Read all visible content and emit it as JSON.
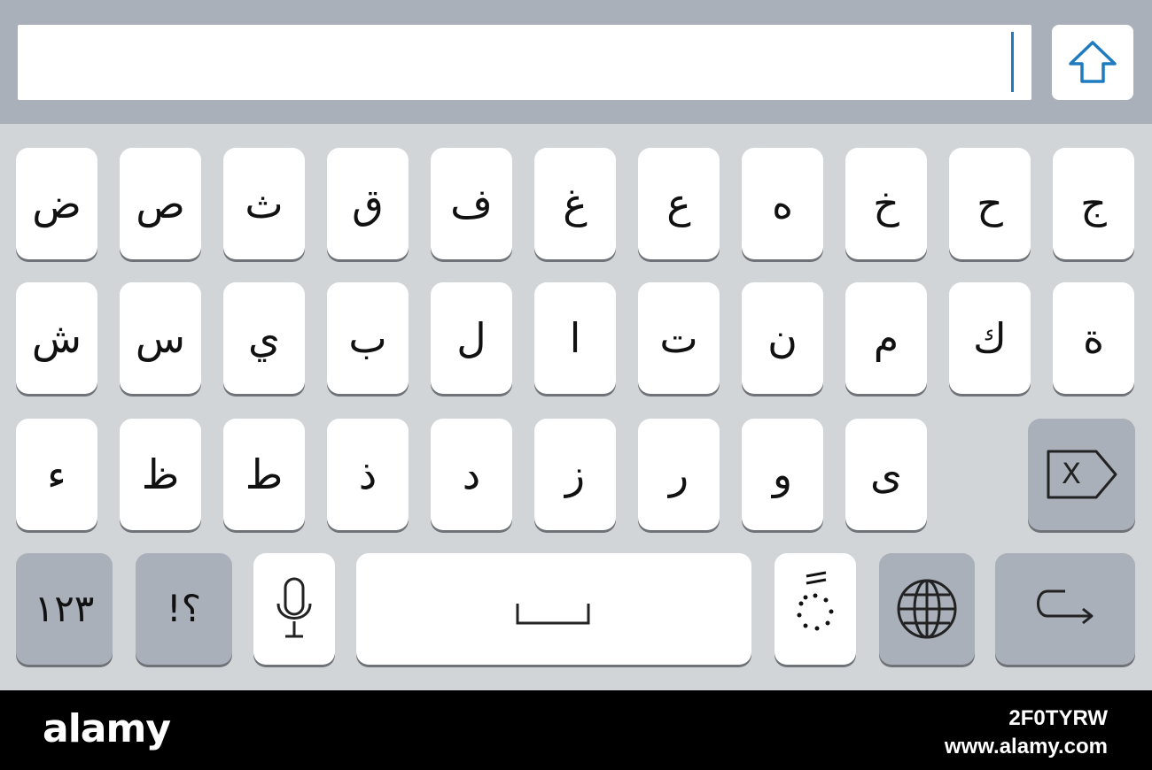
{
  "keyboard": {
    "row1": [
      "ض",
      "ص",
      "ث",
      "ق",
      "ف",
      "غ",
      "ع",
      "ه",
      "خ",
      "ح",
      "ج"
    ],
    "row2": [
      "ش",
      "س",
      "ي",
      "ب",
      "ل",
      "ا",
      "ت",
      "ن",
      "م",
      "ك",
      "ة"
    ],
    "row3": [
      "ء",
      "ظ",
      "ط",
      "ذ",
      "د",
      "ز",
      "ر",
      "و",
      "ى"
    ],
    "numbers_label": "١٢٣",
    "punct_label": "!؟"
  },
  "footer": {
    "brand": "alamy",
    "image_code": "2F0TYRW",
    "site": "www.alamy.com"
  }
}
